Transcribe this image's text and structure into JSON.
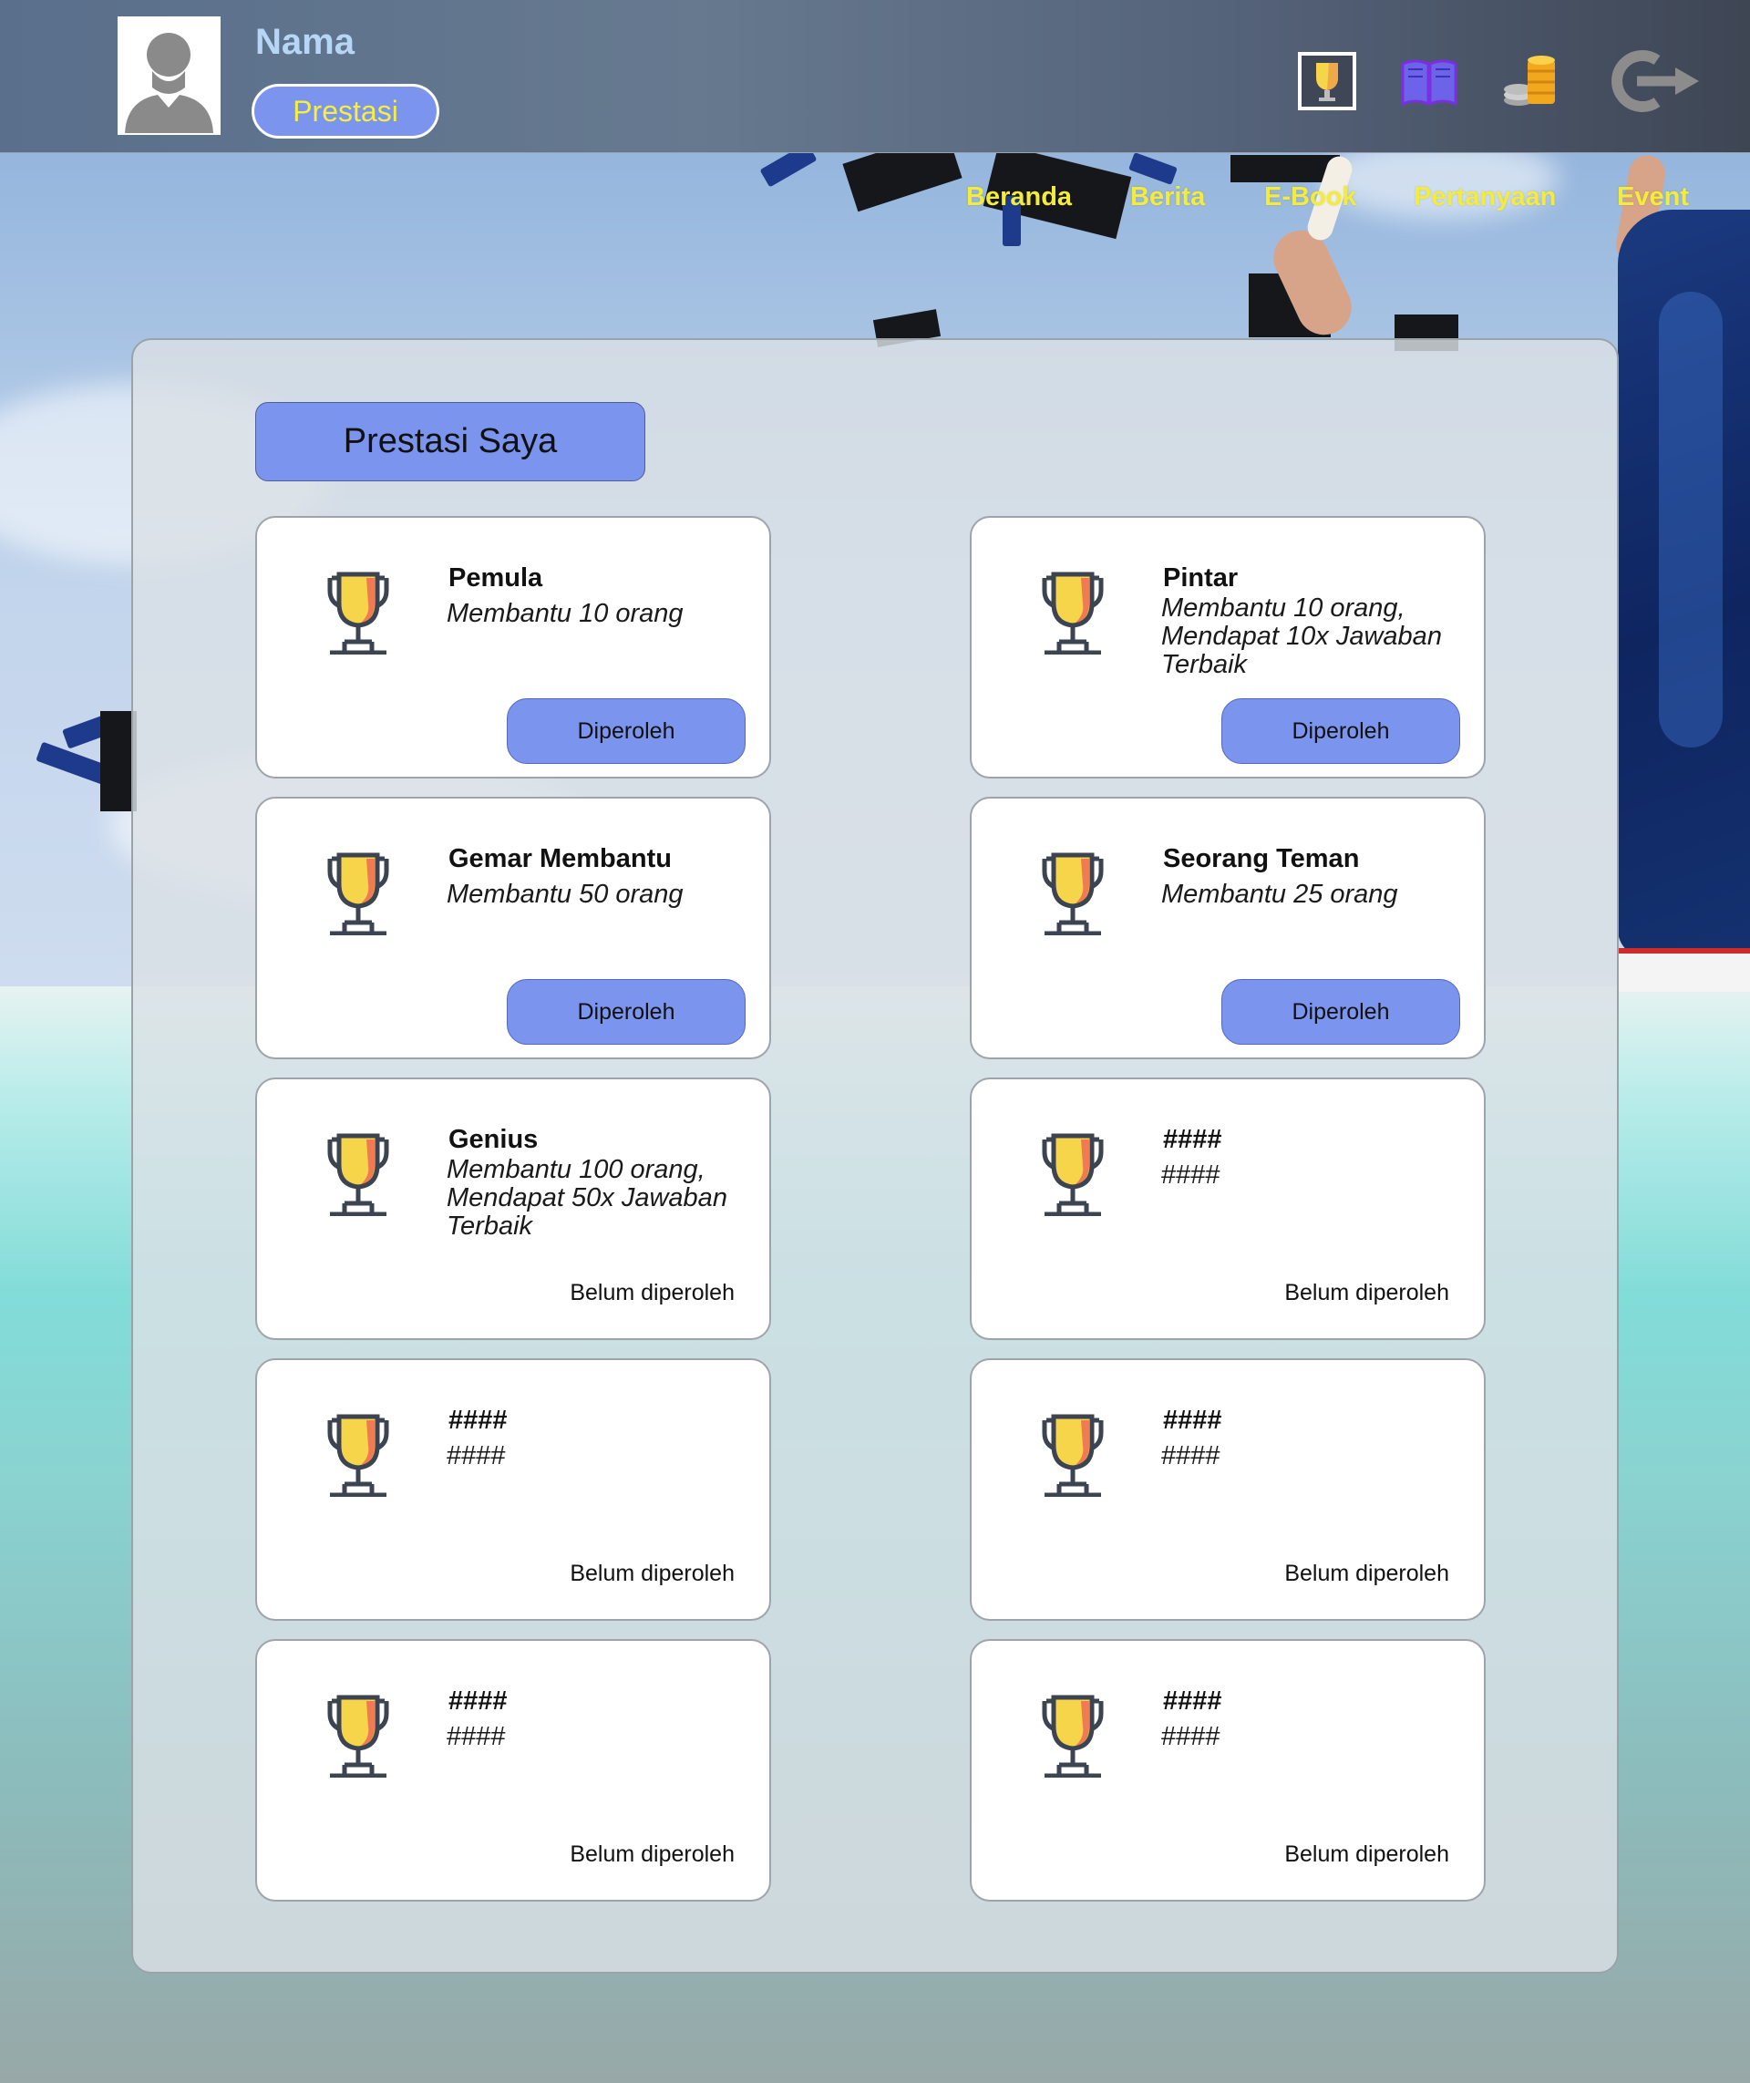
{
  "header": {
    "user_name": "Nama",
    "rank_label": "Prestasi",
    "icons": [
      "trophy-icon",
      "book-icon",
      "coins-icon",
      "logout-icon"
    ]
  },
  "nav": {
    "items": [
      "Beranda",
      "Berita",
      "E-Book",
      "Pertanyaan",
      "Event"
    ]
  },
  "panel": {
    "title": "Prestasi Saya"
  },
  "achievements": [
    {
      "title": "Pemula",
      "desc": "Membantu 10 orang",
      "status": "Diperoleh",
      "earned": true
    },
    {
      "title": "Pintar",
      "desc": "Membantu 10 orang, Mendapat 10x Jawaban Terbaik",
      "status": "Diperoleh",
      "earned": true
    },
    {
      "title": "Gemar Membantu",
      "desc": "Membantu 50 orang",
      "status": "Diperoleh",
      "earned": true
    },
    {
      "title": "Seorang Teman",
      "desc": "Membantu 25 orang",
      "status": "Diperoleh",
      "earned": true
    },
    {
      "title": "Genius",
      "desc": "Membantu 100 orang, Mendapat 50x Jawaban Terbaik",
      "status": "Belum diperoleh",
      "earned": false
    },
    {
      "title": "####",
      "desc": "####",
      "status": "Belum diperoleh",
      "earned": false
    },
    {
      "title": "####",
      "desc": "####",
      "status": "Belum diperoleh",
      "earned": false
    },
    {
      "title": "####",
      "desc": "####",
      "status": "Belum diperoleh",
      "earned": false
    },
    {
      "title": "####",
      "desc": "####",
      "status": "Belum diperoleh",
      "earned": false
    },
    {
      "title": "####",
      "desc": "####",
      "status": "Belum diperoleh",
      "earned": false
    }
  ],
  "colors": {
    "accent": "#7b94ee",
    "nav_text": "#f3ec3a",
    "name_text": "#b6d6f6",
    "trophy_gold": "#f7d54a",
    "trophy_red": "#f07a52",
    "trophy_outline": "#3d4451"
  }
}
